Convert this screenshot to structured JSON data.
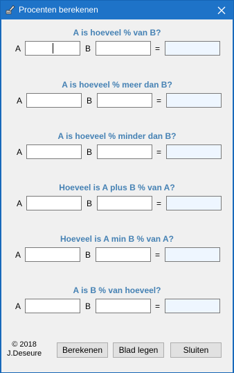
{
  "window": {
    "title": "Procenten berekenen",
    "icon": "app-icon",
    "close_glyph": "✕"
  },
  "sections": [
    {
      "question": "A is hoeveel % van B?",
      "label_a": "A",
      "label_b": "B",
      "equals": "=",
      "value_a": "",
      "value_b": "",
      "result": ""
    },
    {
      "question": "A is hoeveel % meer dan B?",
      "label_a": "A",
      "label_b": "B",
      "equals": "=",
      "value_a": "",
      "value_b": "",
      "result": ""
    },
    {
      "question": "A is hoeveel % minder dan B?",
      "label_a": "A",
      "label_b": "B",
      "equals": "=",
      "value_a": "",
      "value_b": "",
      "result": ""
    },
    {
      "question": "Hoeveel is A plus B % van A?",
      "label_a": "A",
      "label_b": "B",
      "equals": "=",
      "value_a": "",
      "value_b": "",
      "result": ""
    },
    {
      "question": "Hoeveel is A min B % van A?",
      "label_a": "A",
      "label_b": "B",
      "equals": "=",
      "value_a": "",
      "value_b": "",
      "result": ""
    },
    {
      "question": "A is B % van hoeveel?",
      "label_a": "A",
      "label_b": "B",
      "equals": "=",
      "value_a": "",
      "value_b": "",
      "result": ""
    }
  ],
  "footer": {
    "copyright_line1": "© 2018",
    "copyright_line2": "J.Deseure",
    "calculate_label": "Berekenen",
    "clear_label": "Blad legen",
    "close_label": "Sluiten"
  },
  "colors": {
    "titlebar": "#1e73c8",
    "question_text": "#4682b4",
    "result_field_bg": "#eef6ff",
    "client_bg": "#f0f0f0"
  }
}
